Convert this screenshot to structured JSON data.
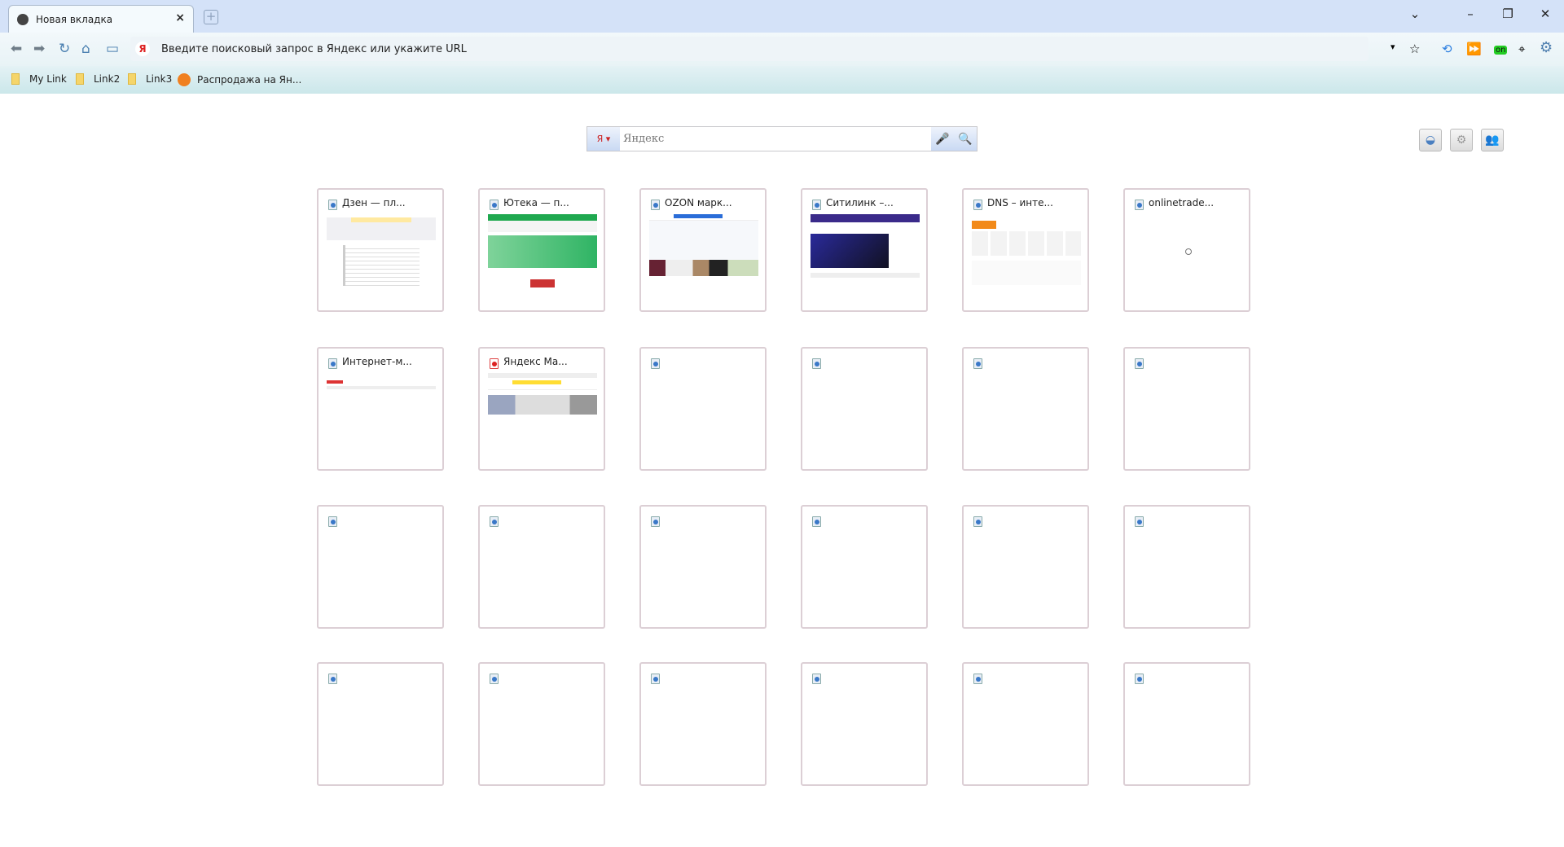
{
  "tab": {
    "title": "Новая вкладка",
    "close": "×",
    "new_tab": "+"
  },
  "window": {
    "dropdown": "⌄",
    "minimize": "–",
    "restore": "❐",
    "close": "✕"
  },
  "toolbar": {
    "back": "⬅",
    "forward": "➡",
    "reload": "↻",
    "home": "⌂",
    "sidebar": "▭",
    "address_placeholder": "Введите поисковый запрос в Яндекс или укажите URL",
    "engine_badge": "Я"
  },
  "extensions": {
    "dropdown": "▾",
    "bookmark_star": "☆",
    "share": "⟲",
    "ff": "⏩",
    "on_badge": "on",
    "pin": "⌖",
    "gear": "⚙"
  },
  "bookmarks": [
    {
      "label": "My Link",
      "icon": "folder"
    },
    {
      "label": "Link2",
      "icon": "folder"
    },
    {
      "label": "Link3",
      "icon": "folder"
    },
    {
      "label": "Распродажа на Ян...",
      "icon": "market"
    }
  ],
  "search": {
    "engine": "Я ▾",
    "placeholder": "Яндекс",
    "mic": "🎤",
    "go": "🔍"
  },
  "side_icons": [
    "store-icon",
    "settings-icon",
    "users-icon"
  ],
  "tiles": [
    {
      "title": "Дзен — пл...",
      "thumb": "dzen"
    },
    {
      "title": "Ютека — п...",
      "thumb": "uteka"
    },
    {
      "title": "OZON марк...",
      "thumb": "ozon"
    },
    {
      "title": "Ситилинк –...",
      "thumb": "citilink"
    },
    {
      "title": "DNS – инте...",
      "thumb": "dns"
    },
    {
      "title": "onlinetrade...",
      "thumb": "loading"
    },
    {
      "title": "Интернет-м...",
      "thumb": "mega"
    },
    {
      "title": "Яндекс Ма...",
      "thumb": "ymarket",
      "favicon": "yandex"
    },
    {
      "title": ""
    },
    {
      "title": ""
    },
    {
      "title": ""
    },
    {
      "title": ""
    },
    {
      "title": ""
    },
    {
      "title": ""
    },
    {
      "title": ""
    },
    {
      "title": ""
    },
    {
      "title": ""
    },
    {
      "title": ""
    },
    {
      "title": ""
    },
    {
      "title": ""
    },
    {
      "title": ""
    },
    {
      "title": ""
    },
    {
      "title": ""
    },
    {
      "title": ""
    }
  ]
}
